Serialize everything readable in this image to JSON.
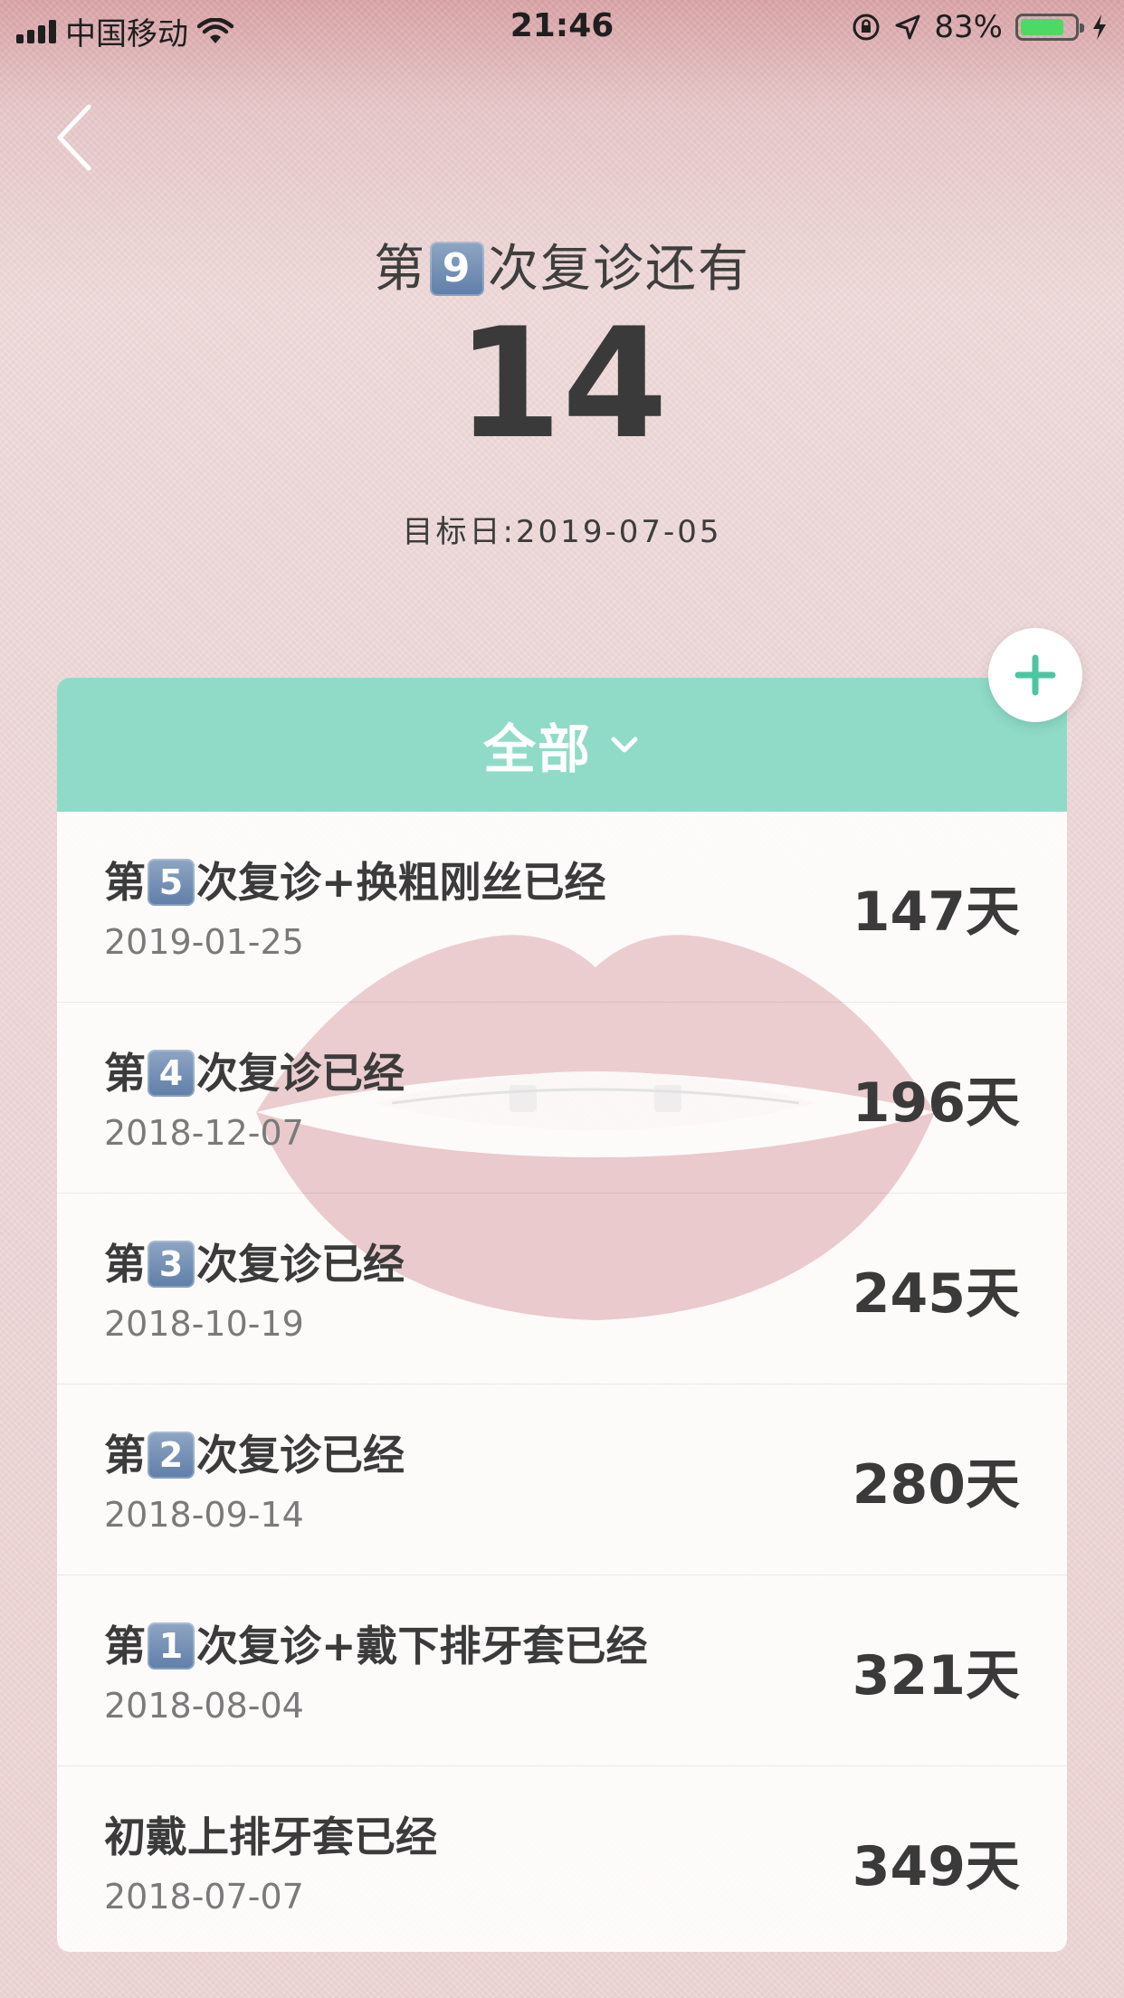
{
  "status_bar": {
    "carrier": "中国移动",
    "time": "21:46",
    "battery_percent_label": "83%",
    "battery_level": 0.83,
    "icons": [
      "signal-icon",
      "wifi-icon",
      "orientation-lock-icon",
      "location-icon",
      "battery-icon",
      "charging-icon"
    ]
  },
  "header": {
    "title_prefix": "第",
    "title_number": "9",
    "title_suffix": "次复诊还有",
    "countdown": "14",
    "target_date": "目标日:2019-07-05"
  },
  "filter": {
    "label": "全部"
  },
  "colors": {
    "accent": "#8fdbc8",
    "add_icon": "#4cc6a0",
    "number_badge": "#6f8db3"
  },
  "items": [
    {
      "prefix": "第",
      "number": "5",
      "suffix": "次复诊+换粗刚丝已经",
      "title_plain": "",
      "date": "2019-01-25",
      "days": "147天"
    },
    {
      "prefix": "第",
      "number": "4",
      "suffix": "次复诊已经",
      "title_plain": "",
      "date": "2018-12-07",
      "days": "196天"
    },
    {
      "prefix": "第",
      "number": "3",
      "suffix": "次复诊已经",
      "title_plain": "",
      "date": "2018-10-19",
      "days": "245天"
    },
    {
      "prefix": "第",
      "number": "2",
      "suffix": "次复诊已经",
      "title_plain": "",
      "date": "2018-09-14",
      "days": "280天"
    },
    {
      "prefix": "第",
      "number": "1",
      "suffix": "次复诊+戴下排牙套已经",
      "title_plain": "",
      "date": "2018-08-04",
      "days": "321天"
    },
    {
      "prefix": "",
      "number": "",
      "suffix": "",
      "title_plain": "初戴上排牙套已经",
      "date": "2018-07-07",
      "days": "349天"
    }
  ]
}
